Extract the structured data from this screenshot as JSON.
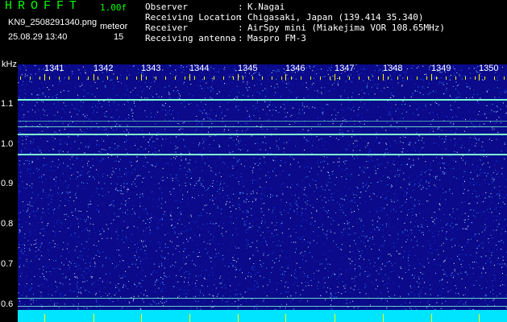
{
  "header": {
    "app_name": "HROFFT",
    "version": "1.00f",
    "filename": "KN9_2508291340.png",
    "mode": "meteor",
    "datetime": "25.08.29 13:40",
    "count": "15"
  },
  "meta": [
    {
      "key": "Observer",
      "sep": ":",
      "value": "K.Nagai"
    },
    {
      "key": "Receiving Location",
      "sep": ":",
      "value": "Chigasaki, Japan (139.414 35.340)"
    },
    {
      "key": "Receiver",
      "sep": ":",
      "value": "AirSpy mini (Miakejima VOR 108.65MHz)"
    },
    {
      "key": "Receiving antenna",
      "sep": ":",
      "value": "Maspro FM-3"
    }
  ],
  "plot": {
    "y_unit": "kHz",
    "y_ticks": [
      "1.1",
      "1.0",
      "0.9",
      "0.8",
      "0.7",
      "0.6"
    ],
    "x_ticks": [
      "1341",
      "1342",
      "1343",
      "1344",
      "1345",
      "1346",
      "1347",
      "1348",
      "1349",
      "1350"
    ],
    "colors": {
      "background": "#0a0a8a",
      "signal": "#7fffd4",
      "floor": "#00e5ff",
      "ticks": "#ffff00"
    }
  }
}
